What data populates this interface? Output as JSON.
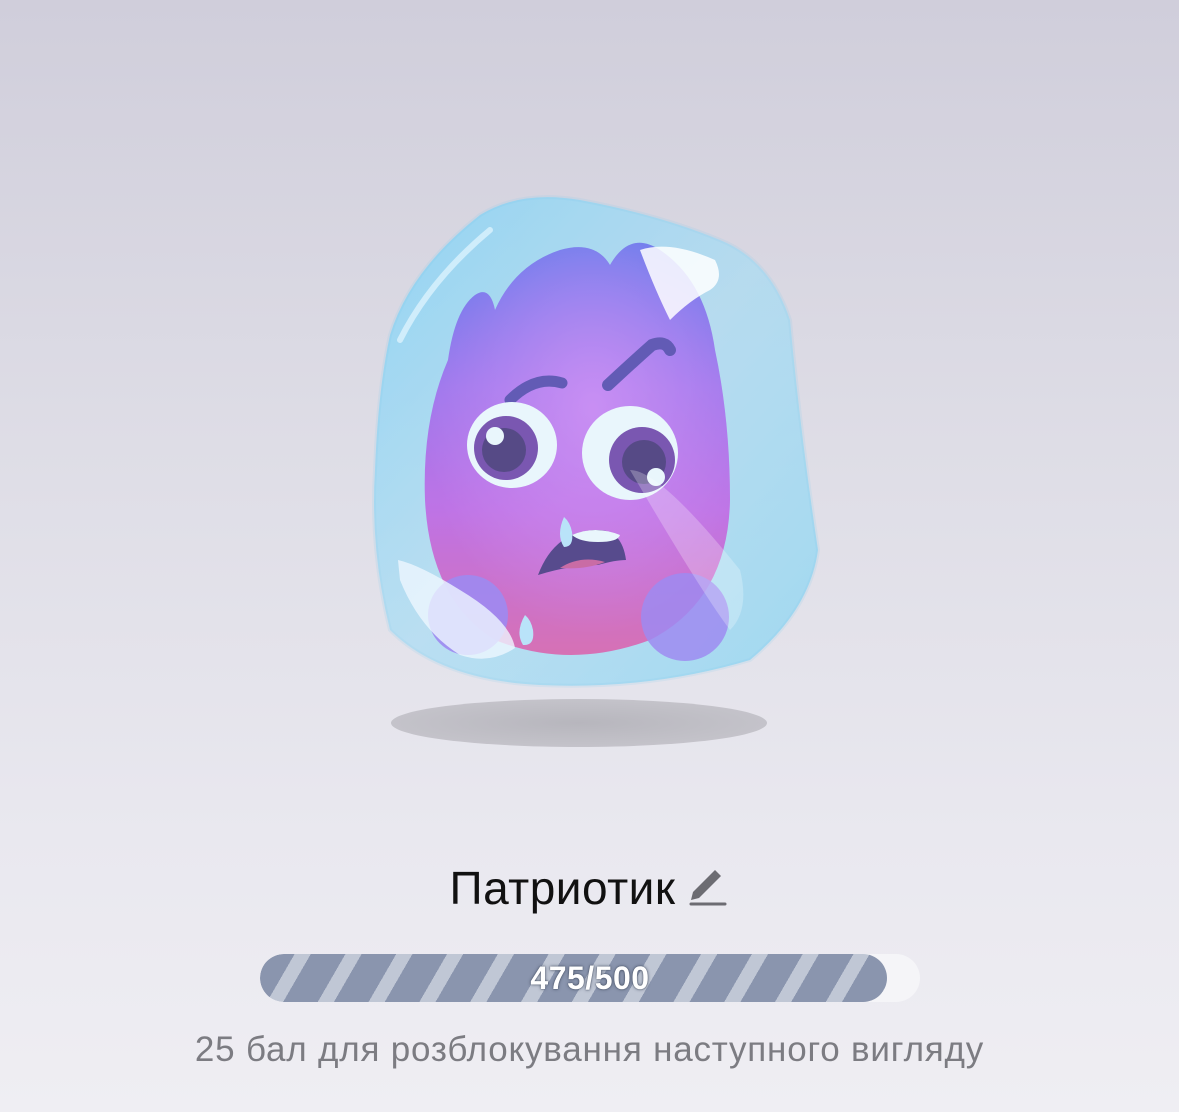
{
  "pet": {
    "name": "Патриотик",
    "character": "frozen-purple-blob-mascot",
    "edit_icon": "pencil-icon"
  },
  "progress": {
    "label": "475/500",
    "current": 475,
    "max": 500,
    "fraction": 0.95,
    "fill_color": "#8a95ae",
    "stripe_color": "#c0c7d5",
    "track_color": "#f5f5f8"
  },
  "hint": "25 бал для розблокування наступного вигляду",
  "colors": {
    "ice": "#8fd7f2",
    "blob_top": "#5b55e6",
    "blob_mid": "#b64fe6",
    "blob_bottom": "#e54aa2"
  }
}
